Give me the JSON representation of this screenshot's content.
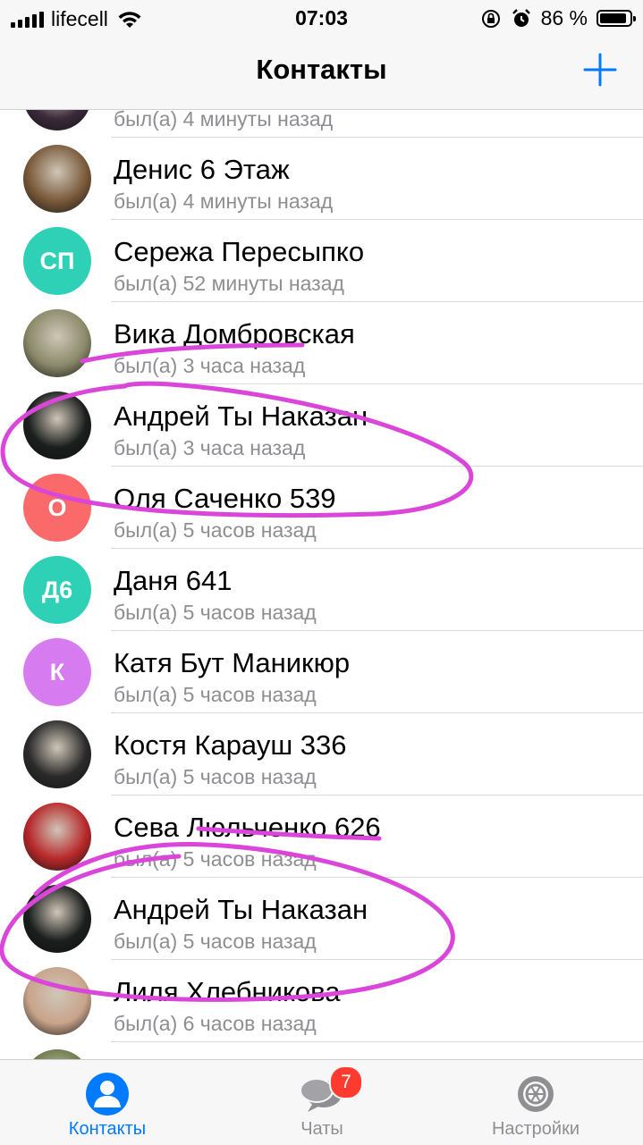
{
  "status_bar": {
    "carrier": "lifecell",
    "time": "07:03",
    "battery": "86 %",
    "battery_level": 0.86
  },
  "navbar": {
    "title": "Контакты",
    "add_icon": "plus-icon"
  },
  "contacts": [
    {
      "name": "",
      "status": "был(а) 4 минуты назад",
      "avatar_type": "photo",
      "color": "#3b2a3a"
    },
    {
      "name": "Денис 6 Этаж",
      "status": "был(а) 4 минуты назад",
      "avatar_type": "photo",
      "color": "#7a5a3a"
    },
    {
      "name": "Сережа Пересыпко",
      "status": "был(а) 52 минуты назад",
      "avatar_type": "initials",
      "initials": "СП",
      "color": "#2fd1b6"
    },
    {
      "name": "Вика Домбровская",
      "status": "был(а) 3 часа назад",
      "avatar_type": "photo",
      "color": "#8a8a6a"
    },
    {
      "name": "Андрей Ты Наказан",
      "status": "был(а) 3 часа назад",
      "avatar_type": "photo",
      "color": "#1a1e1c"
    },
    {
      "name": "Оля Саченко 539",
      "status": "был(а) 5 часов назад",
      "avatar_type": "initials",
      "initials": "О",
      "color": "#fb6a6a"
    },
    {
      "name": "Даня 641",
      "status": "был(а) 5 часов назад",
      "avatar_type": "initials",
      "initials": "Д6",
      "color": "#2fd1b6"
    },
    {
      "name": "Катя Бут Маникюр",
      "status": "был(а) 5 часов назад",
      "avatar_type": "initials",
      "initials": "К",
      "color": "#d77cf0"
    },
    {
      "name": "Костя Карауш 336",
      "status": "был(а) 5 часов назад",
      "avatar_type": "photo",
      "color": "#2a2a2a"
    },
    {
      "name": "Сева Люльченко 626",
      "status": "был(а) 5 часов назад",
      "avatar_type": "photo",
      "color": "#b8282a"
    },
    {
      "name": "Андрей Ты Наказан",
      "status": "был(а) 5 часов назад",
      "avatar_type": "photo",
      "color": "#1a1e1c"
    },
    {
      "name": "Лиля Хлебникова",
      "status": "был(а) 6 часов назад",
      "avatar_type": "photo",
      "color": "#c8a48a"
    },
    {
      "name": "",
      "status": "",
      "avatar_type": "photo",
      "color": "#6b7a4a"
    }
  ],
  "tabbar": {
    "tabs": [
      {
        "label": "Контакты",
        "icon": "contacts-icon",
        "active": true
      },
      {
        "label": "Чаты",
        "icon": "chats-icon",
        "badge": "7"
      },
      {
        "label": "Настройки",
        "icon": "settings-icon"
      }
    ]
  },
  "colors": {
    "accent": "#007aff",
    "inactive": "#8e8e93",
    "annotation": "#d946d9"
  }
}
